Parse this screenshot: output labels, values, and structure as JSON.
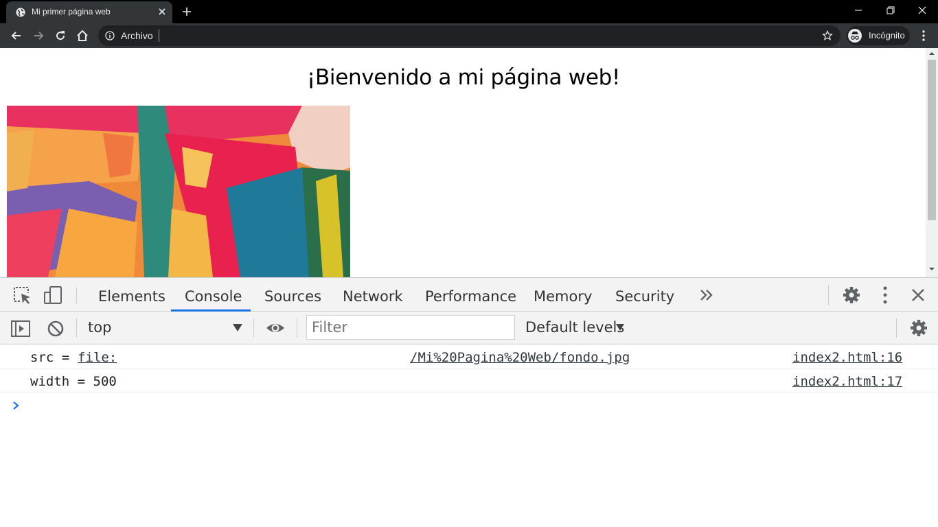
{
  "window": {
    "tab_title": "Mi primer página web",
    "accent_incognito": "#202124"
  },
  "toolbar": {
    "omnibox_label": "Archivo",
    "incognito_label": "Incógnito"
  },
  "page": {
    "heading": "¡Bienvenido a mi página web!",
    "image_alt_icon": "abstract-painting-image"
  },
  "devtools": {
    "tabs": [
      {
        "label": "Elements"
      },
      {
        "label": "Console",
        "active": true
      },
      {
        "label": "Sources"
      },
      {
        "label": "Network"
      },
      {
        "label": "Performance"
      },
      {
        "label": "Memory"
      },
      {
        "label": "Security"
      }
    ],
    "context": "top",
    "filter_placeholder": "Filter",
    "levels": "Default levels",
    "messages": [
      {
        "prefix": "src = ",
        "value": "file:",
        "path": "/Mi%20Pagina%20Web/fondo.jpg",
        "source": "index2.html:16"
      },
      {
        "prefix": "width = 500",
        "value": "",
        "path": "",
        "source": "index2.html:17"
      }
    ],
    "active_tab_color": "#1a73e8"
  }
}
